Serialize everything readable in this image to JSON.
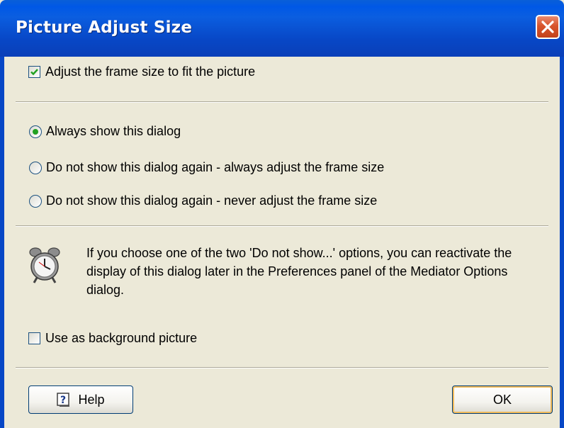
{
  "window": {
    "title": "Picture Adjust Size"
  },
  "options": {
    "adjust_frame_label": "Adjust the frame size to fit the picture",
    "adjust_frame_checked": true,
    "radios": [
      {
        "label": "Always show this dialog",
        "selected": true
      },
      {
        "label": "Do not show this dialog again - always adjust the frame size",
        "selected": false
      },
      {
        "label": "Do not show this dialog again - never adjust the frame size",
        "selected": false
      }
    ]
  },
  "info": {
    "icon": "alarm-clock-icon",
    "text": "If you choose one of the two 'Do not show...' options, you can reactivate the display of this dialog later in the Preferences panel of the Mediator Options dialog."
  },
  "background": {
    "label": "Use as background picture",
    "checked": false
  },
  "buttons": {
    "help_label": "Help",
    "ok_label": "OK"
  },
  "colors": {
    "titlebar": "#0058e6",
    "dialog_bg": "#ece9d8",
    "close_button": "#d8542c",
    "radio_selected": "#21a121"
  }
}
